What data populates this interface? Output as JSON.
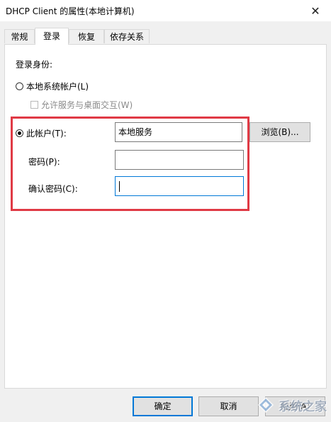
{
  "window": {
    "title": "DHCP Client 的属性(本地计算机)",
    "close_glyph": "✕"
  },
  "tabs": [
    {
      "label": "常规"
    },
    {
      "label": "登录"
    },
    {
      "label": "恢复"
    },
    {
      "label": "依存关系"
    }
  ],
  "active_tab": 1,
  "logon": {
    "section_label": "登录身份:",
    "local_system_label": "本地系统帐户(L)",
    "interact_desktop_label": "允许服务与桌面交互(W)",
    "this_account_label": "此帐户(T):",
    "account_value": "本地服务",
    "browse_button": "浏览(B)...",
    "password_label": "密码(P):",
    "password_value": "",
    "confirm_label": "确认密码(C):",
    "confirm_value": "",
    "selected_option": "this_account"
  },
  "footer": {
    "ok_button": "确定",
    "cancel_button": "取消",
    "apply_button": "应用(A)"
  },
  "watermark": {
    "text": "系统之家"
  },
  "colors": {
    "highlight_border": "#e03a45",
    "focus_border": "#0078d7"
  },
  "icons": [
    "close-icon",
    "radio-icon",
    "checkbox-icon",
    "watermark-logo-icon"
  ]
}
